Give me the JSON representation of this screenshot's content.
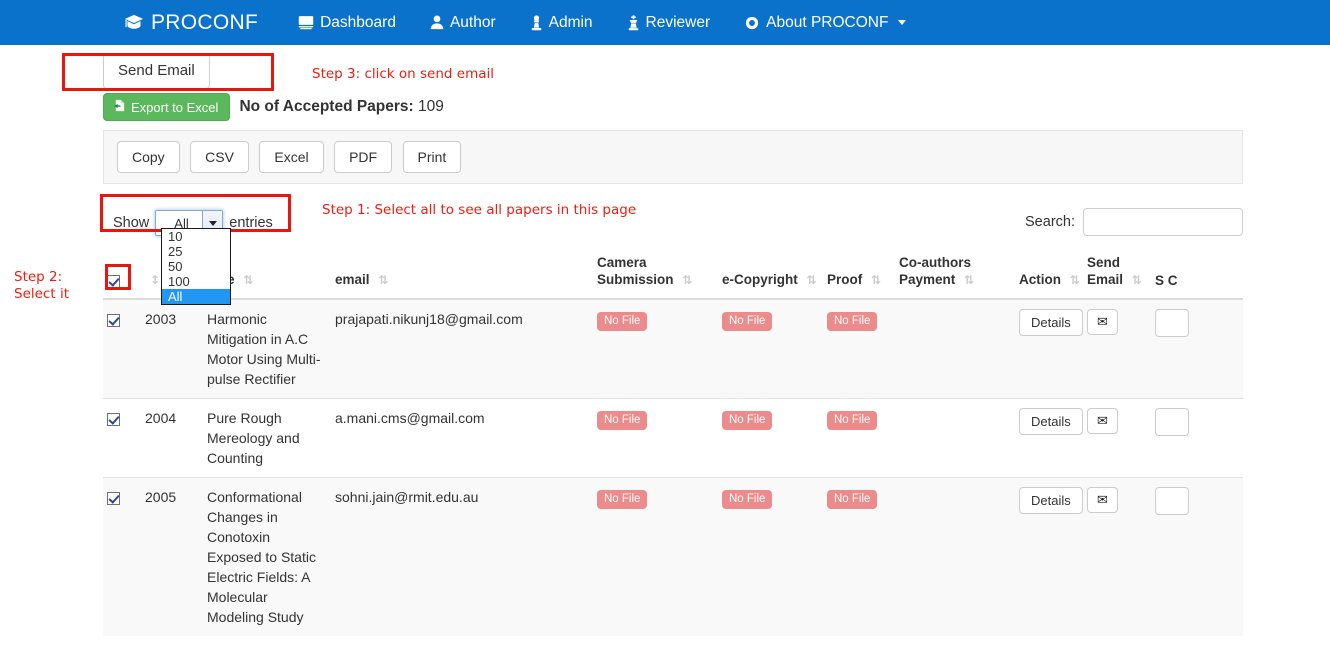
{
  "navbar": {
    "brand": "PROCONF",
    "brand_icon": "graduation-cap-icon",
    "items": [
      {
        "label": "Dashboard",
        "icon": "desktop-icon"
      },
      {
        "label": "Author",
        "icon": "user-icon"
      },
      {
        "label": "Admin",
        "icon": "chess-pawn-icon"
      },
      {
        "label": "Reviewer",
        "icon": "chess-king-icon"
      },
      {
        "label": "About PROCONF",
        "icon": "eye-icon",
        "has_caret": true
      }
    ]
  },
  "toolbar": {
    "send_email_label": "Send Email",
    "export_excel_label": "Export to Excel",
    "export_excel_icon": "file-export-icon",
    "accepted_label": "No of Accepted Papers:",
    "accepted_count": "109",
    "dt_buttons": [
      "Copy",
      "CSV",
      "Excel",
      "PDF",
      "Print"
    ]
  },
  "annotations": [
    {
      "id": "step3",
      "text": "Step 3: click on send email"
    },
    {
      "id": "step1",
      "text": "Step 1: Select all to see all papers in this page"
    },
    {
      "id": "step2",
      "line1": "Step 2:",
      "line2": "Select it"
    }
  ],
  "length_menu": {
    "show_label": "Show",
    "entries_label": "entries",
    "selected": "All",
    "options": [
      "10",
      "25",
      "50",
      "100",
      "All"
    ]
  },
  "search": {
    "label": "Search:",
    "value": "",
    "placeholder": ""
  },
  "table": {
    "columns": [
      {
        "key": "select",
        "label": "",
        "sortable": true
      },
      {
        "key": "id",
        "label": "",
        "sortable": false
      },
      {
        "key": "title",
        "label": "Title",
        "sortable": true
      },
      {
        "key": "email",
        "label": "email",
        "sortable": true
      },
      {
        "key": "camera",
        "label": "Camera Submission",
        "sortable": true
      },
      {
        "key": "ecopyright",
        "label": "e-Copyright",
        "sortable": true
      },
      {
        "key": "proof",
        "label": "Proof",
        "sortable": true
      },
      {
        "key": "coauthors",
        "label": "Co-authors Payment",
        "sortable": true
      },
      {
        "key": "action",
        "label": "Action",
        "sortable": true
      },
      {
        "key": "sendemail",
        "label": "Send Email",
        "sortable": true
      },
      {
        "key": "sendcut",
        "label": "S C",
        "sortable": false
      }
    ],
    "details_label": "Details",
    "mail_icon": "envelope-icon",
    "no_file_label": "No File",
    "rows": [
      {
        "checked": true,
        "id": "2003",
        "title": "Harmonic Mitigation in A.C Motor Using Multi-pulse Rectifier",
        "email": "prajapati.nikunj18@gmail.com",
        "camera": "No File",
        "ecopyright": "No File",
        "proof": "No File",
        "coauthors": ""
      },
      {
        "checked": true,
        "id": "2004",
        "title": "Pure Rough Mereology and Counting",
        "email": "a.mani.cms@gmail.com",
        "camera": "No File",
        "ecopyright": "No File",
        "proof": "No File",
        "coauthors": ""
      },
      {
        "checked": true,
        "id": "2005",
        "title": "Conformational Changes in Conotoxin Exposed to Static Electric Fields: A Molecular Modeling Study",
        "email": "sohni.jain@rmit.edu.au",
        "camera": "No File",
        "ecopyright": "No File",
        "proof": "No File",
        "coauthors": ""
      }
    ]
  },
  "colors": {
    "navbar_blue": "#0b72cb",
    "annotation_red": "#ee1d10",
    "export_green": "#5cb85c",
    "nofile_red": "#eb8b8b",
    "highlight_blue": "#2196f3"
  }
}
